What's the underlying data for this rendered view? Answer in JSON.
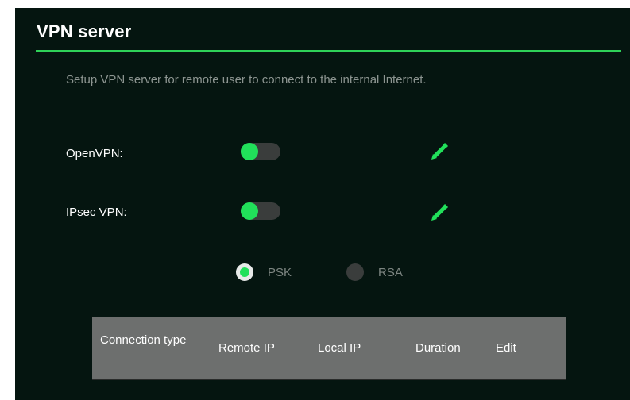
{
  "title": "VPN server",
  "description": "Setup VPN server for remote user to connect to the internal Internet.",
  "colors": {
    "accent": "#21e05a",
    "panel_background": "#051510",
    "toggle_track": "#3a3d3c",
    "table_header": "#6d6f6e"
  },
  "rows": [
    {
      "label": "OpenVPN:",
      "toggle_state": "on",
      "edit_icon": "pencil-icon"
    },
    {
      "label": "IPsec VPN:",
      "toggle_state": "on",
      "edit_icon": "pencil-icon"
    }
  ],
  "auth_mode": {
    "options": [
      {
        "label": "PSK",
        "checked": true
      },
      {
        "label": "RSA",
        "checked": false
      }
    ]
  },
  "table": {
    "columns": [
      "Connection type",
      "Remote IP",
      "Local IP",
      "Duration",
      "Edit"
    ],
    "rows": []
  }
}
